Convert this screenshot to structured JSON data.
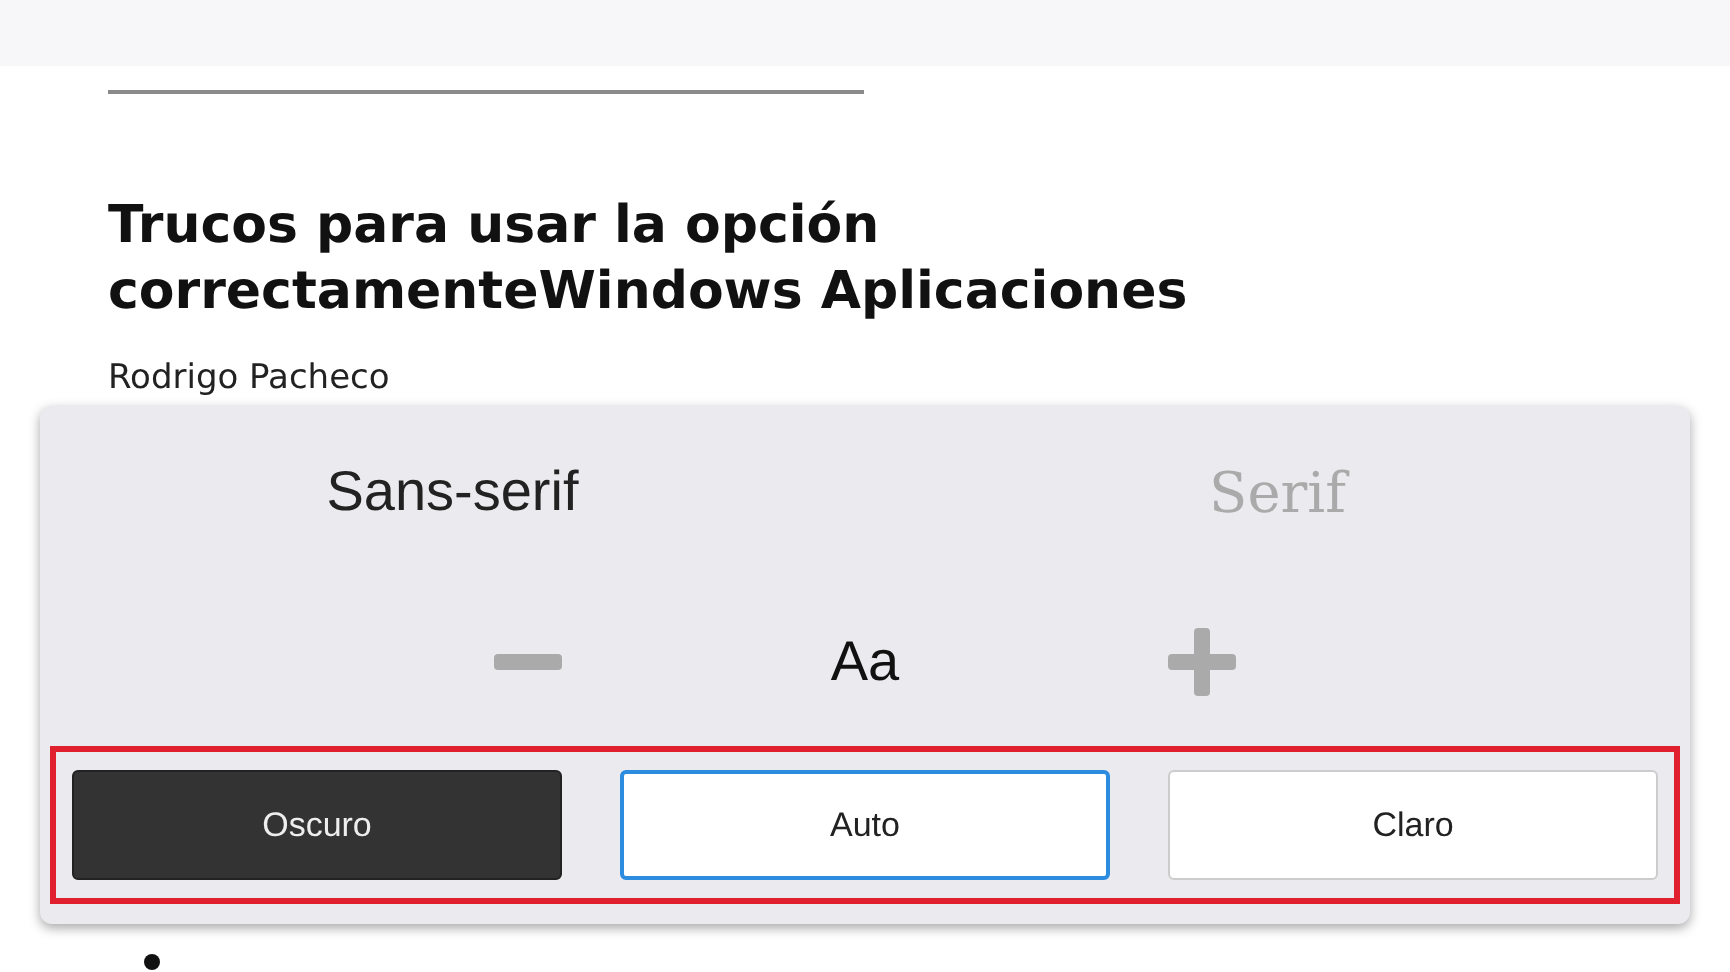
{
  "article": {
    "title": "Trucos para usar la opción correctamenteWindows Aplicaciones",
    "author": "Rodrigo Pacheco"
  },
  "reader_settings": {
    "fonts": [
      {
        "label": "Sans-serif",
        "kind": "sans",
        "selected": true
      },
      {
        "label": "Serif",
        "kind": "serif",
        "selected": false
      }
    ],
    "size_sample": "Aa",
    "themes": [
      {
        "label": "Oscuro",
        "kind": "dark",
        "selected": false
      },
      {
        "label": "Auto",
        "kind": "auto",
        "selected": true
      },
      {
        "label": "Claro",
        "kind": "light",
        "selected": false
      }
    ],
    "themes_highlighted": true
  }
}
